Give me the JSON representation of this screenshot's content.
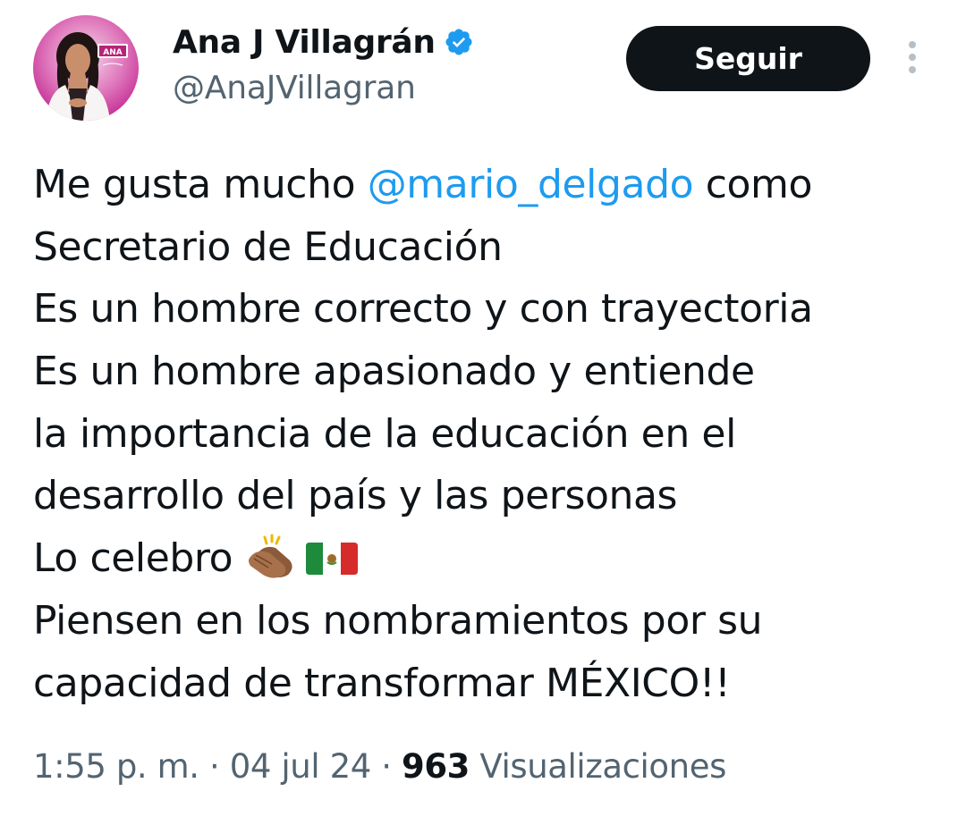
{
  "author": {
    "display_name": "Ana J Villagrán",
    "handle": "@AnaJVillagran",
    "verified": true,
    "avatar_badge_text": "ANA"
  },
  "follow_button": {
    "label": "Seguir"
  },
  "tweet": {
    "lines": [
      {
        "before": "Me gusta mucho ",
        "mention": "@mario_delgado",
        "after": " como"
      },
      {
        "text": "Secretario de Educación"
      },
      {
        "text": "Es un hombre correcto y con trayectoria"
      },
      {
        "text": "Es un hombre apasionado y entiende"
      },
      {
        "text": "la importancia de la educación en el"
      },
      {
        "text": "desarrollo del país y las personas"
      },
      {
        "text": "Lo celebro "
      },
      {
        "text": "Piensen en los nombramientos por su"
      },
      {
        "text": "capacidad de transformar MÉXICO!!"
      }
    ],
    "emojis": [
      "clapping-hands",
      "mexico-flag"
    ]
  },
  "meta": {
    "time": "1:55 p. m.",
    "separator": " · ",
    "date": "04 jul 24",
    "views_count": "963",
    "views_label": " Visualizaciones"
  },
  "colors": {
    "text": "#0f1419",
    "secondary": "#536471",
    "link": "#1d9bf0",
    "verified": "#1d9bf0",
    "follow_bg": "#0f1419",
    "follow_text": "#ffffff"
  },
  "icons": {
    "verified": "verified-badge-icon",
    "more": "more-options-icon"
  }
}
